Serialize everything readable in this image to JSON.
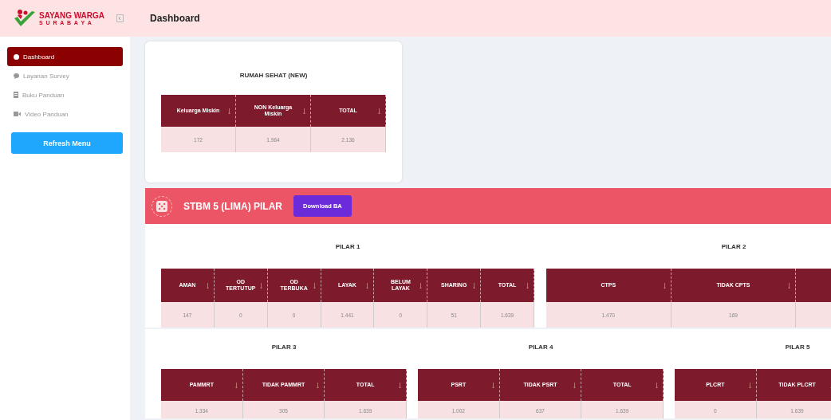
{
  "logo": {
    "line1": "SAYANG WARGA",
    "line2": "S U R A B A Y A"
  },
  "header": {
    "title": "Dashboard"
  },
  "sidebar": {
    "items": [
      {
        "label": "Dashboard",
        "selected": true
      },
      {
        "label": "Layanan Survey",
        "selected": false
      },
      {
        "label": "Buku Panduan",
        "selected": false
      },
      {
        "label": "Video Panduan",
        "selected": false
      }
    ],
    "refresh_button": "Refresh Menu"
  },
  "rumah_sehat": {
    "title": "RUMAH SEHAT (NEW)",
    "columns": [
      {
        "label": "Keluarga Miskin"
      },
      {
        "label": "NON Keluarga Miskin"
      },
      {
        "label": "TOTAL"
      }
    ],
    "values": [
      "172",
      "1.964",
      "2.136"
    ]
  },
  "stbm": {
    "title": "STBM 5 (LIMA) PILAR",
    "download_button": "Download BA",
    "rows": [
      {
        "pillars": [
          {
            "title": "PILAR 1",
            "columns": [
              {
                "label": "AMAN"
              },
              {
                "label": "OD TERTUTUP"
              },
              {
                "label": "OD TERBUKA"
              },
              {
                "label": "LAYAK"
              },
              {
                "label": "BELUM LAYAK"
              },
              {
                "label": "SHARING"
              },
              {
                "label": "TOTAL"
              }
            ],
            "values": [
              "147",
              "0",
              "0",
              "1.441",
              "0",
              "51",
              "1.639"
            ]
          },
          {
            "title": "PILAR 2",
            "columns": [
              {
                "label": "CTPS"
              },
              {
                "label": "TIDAK CPTS"
              },
              {}
            ],
            "values": [
              "1.470",
              "169"
            ]
          }
        ]
      },
      {
        "pillars": [
          {
            "title": "PILAR 3",
            "columns": [
              {
                "label": "PAMMRT"
              },
              {
                "label": "TIDAK PAMMRT"
              },
              {
                "label": "TOTAL"
              }
            ],
            "values": [
              "1.334",
              "305",
              "1.639"
            ]
          },
          {
            "title": "PILAR 4",
            "columns": [
              {
                "label": "PSRT"
              },
              {
                "label": "TIDAK PSRT"
              },
              {
                "label": "TOTAL"
              }
            ],
            "values": [
              "1.002",
              "637",
              "1.639"
            ]
          },
          {
            "title": "PILAR 5",
            "columns": [
              {
                "label": "PLCRT"
              },
              {
                "label": "TIDAK PLCRT"
              }
            ],
            "values": [
              "0",
              "1.639"
            ]
          }
        ]
      }
    ]
  }
}
